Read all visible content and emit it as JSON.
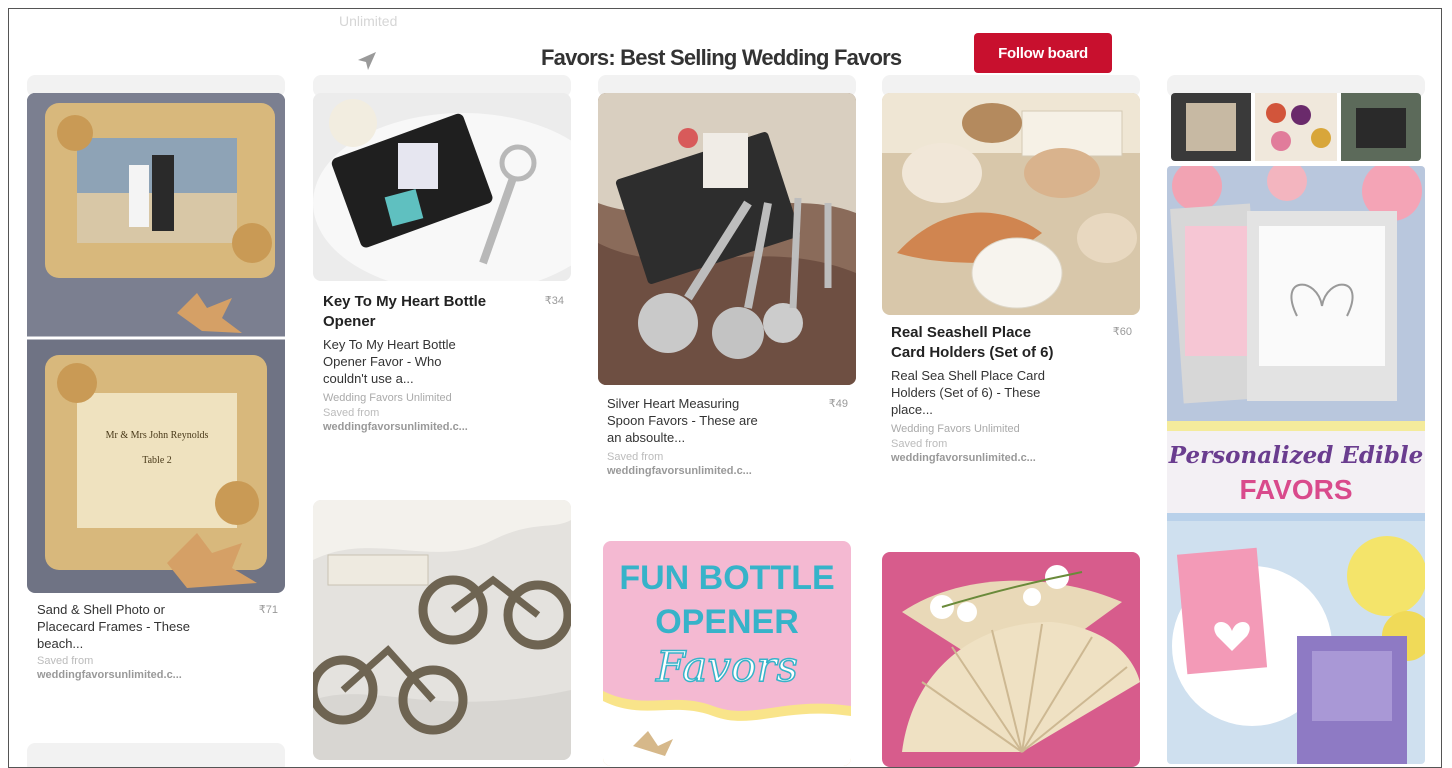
{
  "header": {
    "faded_text": "Unlimited",
    "board_title": "Favors: Best Selling Wedding Favors",
    "follow_label": "Follow board"
  },
  "pins": [
    {
      "desc": "Sand & Shell Photo or Placecard Frames - These beach...",
      "price": "₹71",
      "saved_label": "Saved from",
      "url": "weddingfavorsunlimited.c..."
    },
    {
      "title": "Key To My Heart Bottle Opener",
      "price": "₹34",
      "desc": "Key To My Heart Bottle Opener Favor - Who couldn't use a...",
      "source": "Wedding Favors Unlimited",
      "saved_label": "Saved from",
      "url": "weddingfavorsunlimited.c..."
    },
    {
      "desc": "Silver Heart Measuring Spoon Favors - These are an absoulte...",
      "price": "₹49",
      "saved_label": "Saved from",
      "url": "weddingfavorsunlimited.c..."
    },
    {
      "title": "Real Seashell Place Card Holders (Set of 6)",
      "price": "₹60",
      "desc": "Real Sea Shell Place Card Holders (Set of 6) - These place...",
      "source": "Wedding Favors Unlimited",
      "saved_label": "Saved from",
      "url": "weddingfavorsunlimited.c..."
    }
  ],
  "frame_card": {
    "line1": "Mr & Mrs John Reynolds",
    "line2": "Table 2"
  },
  "bottle_opener_image": {
    "line1": "FUN BOTTLE",
    "line2": "OPENER",
    "line3": "Favors"
  },
  "edible_favors_image": {
    "line1": "Personalized Edible",
    "line2": "FAVORS"
  },
  "colors": {
    "follow_button": "#c8102e",
    "edible_script": "#6a3d8f",
    "edible_caps": "#d94a8c",
    "bottle_pink": "#f4b9d2",
    "bottle_text": "#36b3c9"
  }
}
